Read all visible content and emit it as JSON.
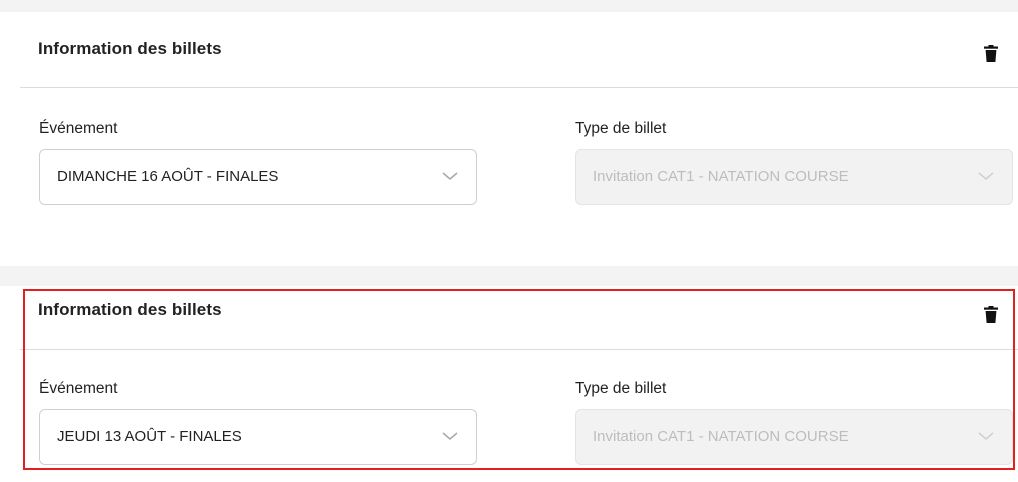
{
  "cards": [
    {
      "title": "Information des billets",
      "event_label": "Événement",
      "event_value": "DIMANCHE 16 AOÛT - FINALES",
      "ticket_label": "Type de billet",
      "ticket_value": "Invitation CAT1 - NATATION COURSE"
    },
    {
      "title": "Information des billets",
      "event_label": "Événement",
      "event_value": "JEUDI 13 AOÛT - FINALES",
      "ticket_label": "Type de billet",
      "ticket_value": "Invitation CAT1 - NATATION COURSE"
    }
  ],
  "icons": {
    "delete": "trash-icon",
    "dropdown": "chevron-down-icon"
  },
  "colors": {
    "highlight": "#e32020",
    "divider": "#dcdcdc",
    "disabled_bg": "#f2f2f2",
    "disabled_text": "#bdbdbd"
  }
}
